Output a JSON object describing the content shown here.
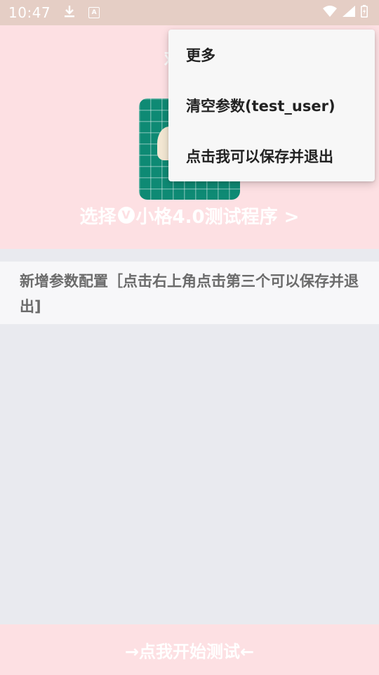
{
  "status_bar": {
    "time": "10:47",
    "badge_letter": "A",
    "icons": [
      "download-icon",
      "a-badge-icon",
      "wifi-icon",
      "signal-icon",
      "battery-icon"
    ]
  },
  "header": {
    "welcome": "欢迎使",
    "select_prefix": "选择",
    "v_badge": "V",
    "select_suffix": "小格4.0测试程序 >"
  },
  "config_item": {
    "text": "新增参数配置［点击右上角点击第三个可以保存并退出]"
  },
  "menu": {
    "items": [
      {
        "label": "更多"
      },
      {
        "label": "清空参数(test_user)"
      },
      {
        "label": "点击我可以保存并退出"
      }
    ]
  },
  "bottom": {
    "start_label": "→点我开始测试←"
  },
  "colors": {
    "status_bar": "#e5cec5",
    "header_bg": "#fde0e3",
    "logo_green": "#0e8a74",
    "page_bg": "#e9eaef"
  }
}
